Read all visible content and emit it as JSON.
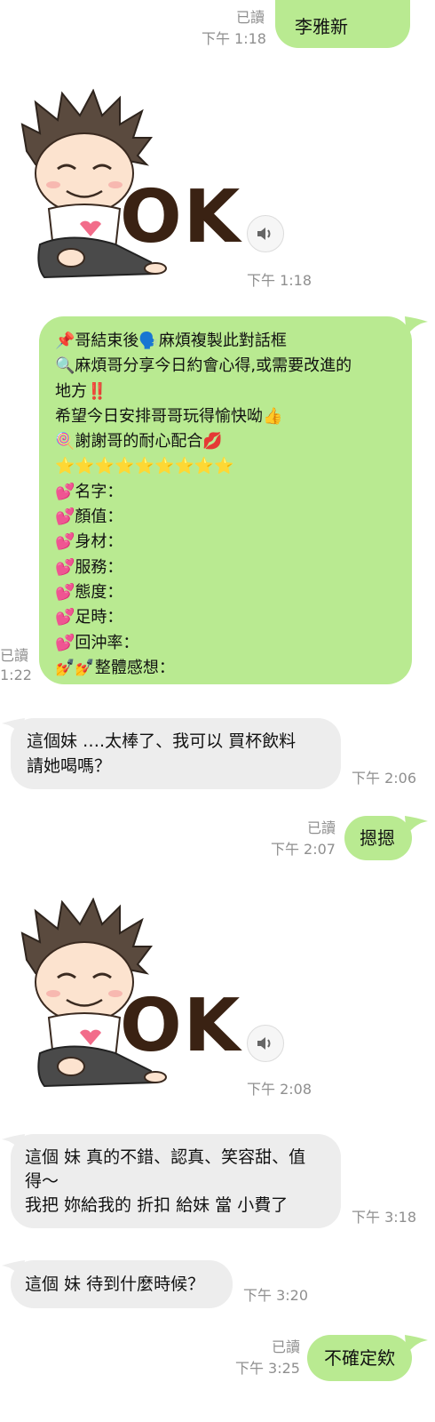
{
  "messages": {
    "m1": {
      "text": "李雅新",
      "read": "已讀",
      "time": "下午 1:18"
    },
    "m2": {
      "sticker_text": "OK",
      "time": "下午 1:18"
    },
    "m3": {
      "lines": [
        "📌哥結束後🗣️麻煩複製此對話框",
        "🔍麻煩哥分享今日約會心得,或需要改進的",
        "地方‼️",
        "希望今日安排哥哥玩得愉快呦👍",
        "🍭謝謝哥的耐心配合💋",
        "⭐⭐⭐⭐⭐⭐⭐⭐⭐",
        "💕名字：",
        "💕顏值：",
        "💕身材：",
        "💕服務：",
        "💕態度：",
        "💕足時：",
        "💕回沖率：",
        "💅💅整體感想："
      ],
      "read": "已讀",
      "time": "1:22"
    },
    "m4": {
      "lines": [
        "這個妹 ….太棒了、我可以 買杯飲料",
        "請她喝嗎？"
      ],
      "time": "下午 2:06"
    },
    "m5": {
      "text": "摁摁",
      "read": "已讀",
      "time": "下午 2:07"
    },
    "m6": {
      "sticker_text": "OK",
      "time": "下午 2:08"
    },
    "m7": {
      "lines": [
        "這個 妹 真的不錯、認真、笑容甜、值",
        "得～",
        "我把 妳給我的 折扣 給妹 當 小費了"
      ],
      "time": "下午 3:18"
    },
    "m8": {
      "text": "這個 妹 待到什麼時候？",
      "time": "下午 3:20"
    },
    "m9": {
      "text": "不確定欸",
      "read": "已讀",
      "time": "下午 3:25"
    }
  },
  "colors": {
    "outgoing": "#b9ea91",
    "incoming": "#ededed",
    "meta": "#8f8f8f"
  },
  "icons": {
    "sticker": "cartoon-boy-sticker",
    "sound": "speaker-icon"
  }
}
